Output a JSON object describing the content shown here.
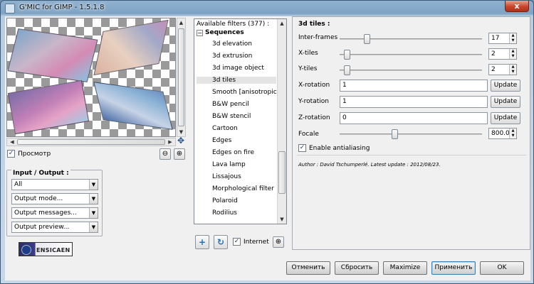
{
  "window": {
    "title": "G'MIC for GIMP - 1.5.1.8",
    "close_glyph": "x"
  },
  "preview": {
    "checkbox_label": "Просмотр",
    "checked": true
  },
  "io_group": {
    "title": "Input / Output :",
    "combos": [
      "All",
      "Output mode...",
      "Output messages...",
      "Output preview..."
    ]
  },
  "logo": {
    "text": "ENSICAEN",
    "mark": "GM"
  },
  "filters": {
    "header": "Available filters (377) :",
    "category": "Sequences",
    "items": [
      "3d elevation",
      "3d extrusion",
      "3d image object",
      "3d tiles",
      "Smooth [anisotropic]",
      "B&W pencil",
      "B&W stencil",
      "Cartoon",
      "Edges",
      "Edges on fire",
      "Lava lamp",
      "Lissajous",
      "Morphological filter",
      "Polaroid",
      "Rodilius"
    ],
    "selected_index": 3,
    "internet_label": "Internet",
    "internet_checked": true
  },
  "panel": {
    "title": "3d tiles :",
    "sliders": [
      {
        "label": "Inter-frames",
        "value": "17",
        "level": 0.18
      },
      {
        "label": "X-tiles",
        "value": "2",
        "level": 0.03
      },
      {
        "label": "Y-tiles",
        "value": "2",
        "level": 0.03
      },
      {
        "label": "Focale",
        "value": "800.00",
        "level": 0.38
      }
    ],
    "rotations": [
      {
        "label": "X-rotation",
        "value": "1"
      },
      {
        "label": "Y-rotation",
        "value": "1"
      },
      {
        "label": "Z-rotation",
        "value": "0"
      }
    ],
    "update_label": "Update",
    "antialias_label": "Enable antialiasing",
    "antialias_checked": true,
    "author_line": "Author : David Tschumperlé.     Latest update : 2012/08/23."
  },
  "buttons": {
    "cancel": "Отменить",
    "reset": "Сбросить",
    "maximize": "Maximize",
    "apply": "Применить",
    "ok": "OK"
  },
  "icons": {
    "zoom_out": "⊖",
    "zoom_in": "⊕",
    "move": "✥",
    "add": "+",
    "refresh": "↻",
    "zoom": "⊕"
  }
}
